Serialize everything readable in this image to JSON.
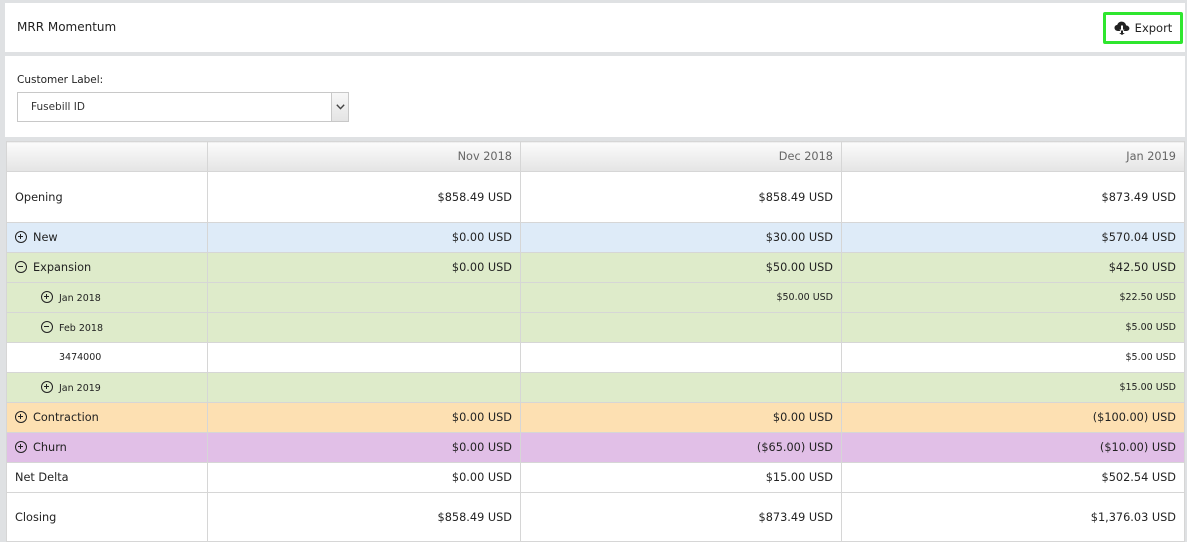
{
  "panel": {
    "title": "MRR Momentum",
    "export_label": "Export"
  },
  "filter": {
    "label": "Customer Label:",
    "selected": "Fusebill ID"
  },
  "table": {
    "columns": [
      "",
      "Nov 2018",
      "Dec 2018",
      "Jan 2019"
    ],
    "rows": [
      {
        "label": "Opening",
        "values": [
          "$858.49 USD",
          "$858.49 USD",
          "$873.49 USD"
        ]
      },
      {
        "label": "New",
        "toggle": "plus",
        "values": [
          "$0.00 USD",
          "$30.00 USD",
          "$570.04 USD"
        ]
      },
      {
        "label": "Expansion",
        "toggle": "minus",
        "values": [
          "$0.00 USD",
          "$50.00 USD",
          "$42.50 USD"
        ]
      },
      {
        "label": "Jan 2018",
        "toggle": "plus",
        "values": [
          "",
          "$50.00 USD",
          "$22.50 USD"
        ]
      },
      {
        "label": "Feb 2018",
        "toggle": "minus",
        "values": [
          "",
          "",
          "$5.00 USD"
        ]
      },
      {
        "label": "3474000",
        "values": [
          "",
          "",
          "$5.00 USD"
        ]
      },
      {
        "label": "Jan 2019",
        "toggle": "plus",
        "values": [
          "",
          "",
          "$15.00 USD"
        ]
      },
      {
        "label": "Contraction",
        "toggle": "plus",
        "values": [
          "$0.00 USD",
          "$0.00 USD",
          "($100.00) USD"
        ]
      },
      {
        "label": "Churn",
        "toggle": "plus",
        "values": [
          "$0.00 USD",
          "($65.00) USD",
          "($10.00) USD"
        ]
      },
      {
        "label": "Net Delta",
        "values": [
          "$0.00 USD",
          "$15.00 USD",
          "$502.54 USD"
        ]
      },
      {
        "label": "Closing",
        "values": [
          "$858.49 USD",
          "$873.49 USD",
          "$1,376.03 USD"
        ]
      }
    ]
  },
  "icons": {
    "export": "cloud-download-icon",
    "select": "chevron-down-icon",
    "expand": "plus-circle-icon",
    "collapse": "minus-circle-icon"
  },
  "colors": {
    "export_highlight": "#2ee62e",
    "new_row": "#deebf8",
    "expansion_row": "#deebca",
    "contraction_row": "#fde0b2",
    "churn_row": "#e1bfe7"
  }
}
